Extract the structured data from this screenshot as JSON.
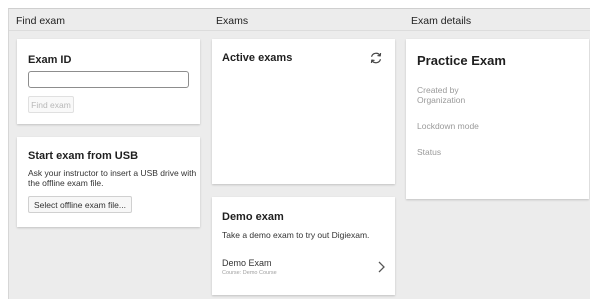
{
  "columns": {
    "find_exam": "Find exam",
    "exams": "Exams",
    "exam_details": "Exam details"
  },
  "exam_id_card": {
    "title": "Exam ID",
    "input_value": "",
    "input_placeholder": "",
    "find_button_label": "Find exam"
  },
  "usb_card": {
    "title": "Start exam from USB",
    "description_line1": "Ask your instructor to insert a USB drive with",
    "description_line2": "the offline exam file.",
    "select_button_label": "Select offline exam file..."
  },
  "active_exams_card": {
    "title": "Active exams",
    "refresh_icon": "refresh-icon"
  },
  "demo_exam_card": {
    "title": "Demo exam",
    "description": "Take a demo exam to try out Digiexam.",
    "item_name": "Demo Exam",
    "item_course": "Course: Demo Course",
    "chevron_icon": "chevron-right-icon"
  },
  "exam_details_card": {
    "title": "Practice Exam",
    "created_by_label": "Created by",
    "created_by_value": "Organization",
    "lockdown_label": "Lockdown mode",
    "status_label": "Status"
  }
}
